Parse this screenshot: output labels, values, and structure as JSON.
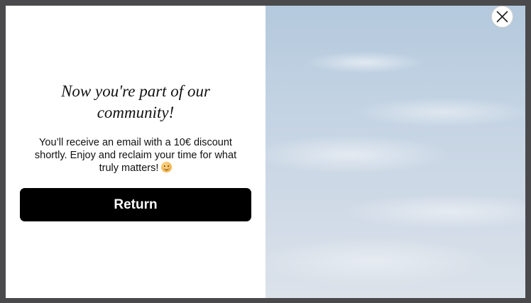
{
  "modal": {
    "headline": "Now you're part of our community!",
    "message": "You’ll receive an email with a 10€ discount shortly. Enjoy and reclaim your time for what truly matters!",
    "emoji_icon": "smiling-face-icon",
    "return_label": "Return",
    "close_icon": "close-icon",
    "image_description": "sky-with-clouds-image"
  },
  "colors": {
    "button_bg": "#000000",
    "button_text": "#ffffff",
    "overlay": "#4a4a4c"
  }
}
